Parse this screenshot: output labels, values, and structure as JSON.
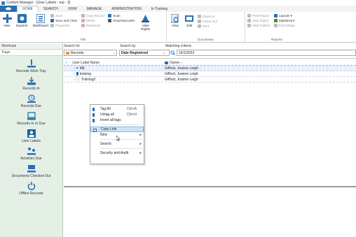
{
  "window": {
    "title": "Content Manager - [User Labels - top - 3]"
  },
  "tabs": [
    {
      "label": ""
    },
    {
      "label": "HOME"
    },
    {
      "label": "SEARCH"
    },
    {
      "label": "VIEW"
    },
    {
      "label": "MANAGE"
    },
    {
      "label": "ADMINISTRATION"
    },
    {
      "label": "In Training"
    }
  ],
  "ribbon": {
    "file_group": {
      "label": "File",
      "new_label": "New",
      "explorer_label": "Explorer",
      "dashboard_label": "Dashboard",
      "save_label": "Save",
      "save_clear_label": "Save and Clear",
      "properties_label": "Properties",
      "copy_record_label": "Copy Record",
      "delete_label": "Delete",
      "reference_label": "Reference",
      "scan_label": "Scan",
      "read_barcodes_label": "Read Barcodes",
      "view_rights_label": "View Rights"
    },
    "documents_group": {
      "label": "Documents",
      "view_label": "View",
      "edit_label": "Edit",
      "check_in_label": "Check In",
      "check_out_label": "Check Out",
      "print_label": "Print"
    },
    "reports_group": {
      "label": "Reports",
      "print_report_label": "Print Report",
      "xml_export_label": "XML Export",
      "web_publish_label": "Web Publish",
      "layouts_label": "Layouts",
      "statistical_label": "Statistical",
      "print_merge_label": "Print Merge"
    }
  },
  "sidebar": {
    "shortcuts_label": "Shortcuts",
    "trays_label": "Trays",
    "items": [
      {
        "label": "Records Work Tray"
      },
      {
        "label": "Records In"
      },
      {
        "label": "Records Due"
      },
      {
        "label": "Records In or Due"
      },
      {
        "label": "User Labels"
      },
      {
        "label": "Activities Due"
      },
      {
        "label": "Documents Checked Out"
      },
      {
        "label": "Offline Records"
      }
    ]
  },
  "search": {
    "search_for_label": "Search for",
    "search_by_label": "Search by",
    "matching_label": "Matching criteria",
    "search_for_value": "Records",
    "search_by_value": "Date Registered",
    "matching_value": "16/1/2023"
  },
  "grid": {
    "col_label": "User Label Name",
    "col_owner": "Owner",
    "rows": [
      {
        "name": "ME",
        "owner": "Gifford, Joanne Leigh"
      },
      {
        "name": "training",
        "owner": "Gifford, Joanne Leigh"
      },
      {
        "name": "Training2",
        "owner": "Gifford, Joanne Leigh"
      }
    ]
  },
  "context_menu": {
    "items": [
      {
        "label": "Tag All",
        "shortcut": "Ctrl+A"
      },
      {
        "label": "Untag all",
        "shortcut": "Ctrl+U"
      },
      {
        "label": "Invert all tags",
        "shortcut": ""
      },
      {
        "label": "Copy Link",
        "shortcut": ""
      },
      {
        "label": "New",
        "shortcut": ""
      },
      {
        "label": "Search",
        "shortcut": ""
      },
      {
        "label": "Security and Audit",
        "shortcut": ""
      }
    ]
  },
  "colors": {
    "accent": "#2b6fb3",
    "sidebar_bg": "#e4f0e6",
    "menu_highlight": "#cfe3f7"
  }
}
